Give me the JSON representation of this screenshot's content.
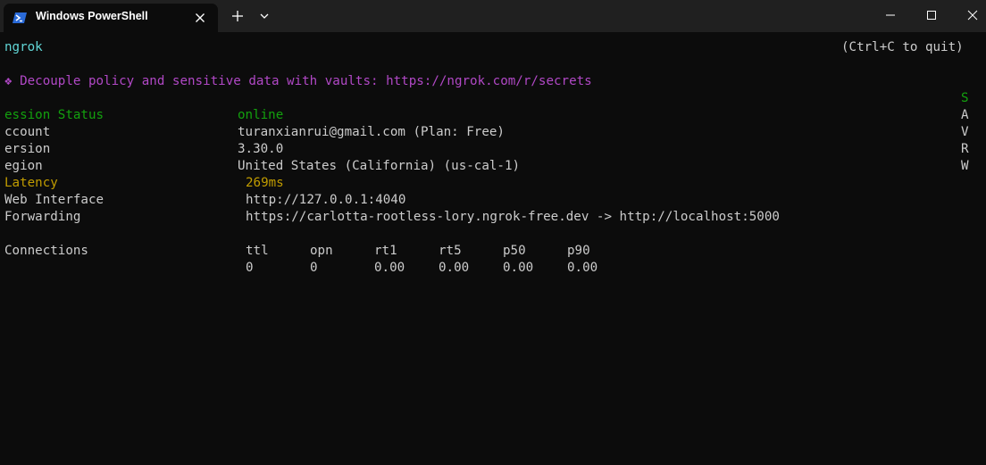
{
  "window": {
    "tab_title": "Windows PowerShell",
    "tab_icon": "powershell-icon",
    "close_tab_icon": "close-icon",
    "new_tab_icon": "plus-icon",
    "dropdown_icon": "chevron-down-icon",
    "minimize_icon": "minimize-icon",
    "maximize_icon": "maximize-icon",
    "close_icon": "close-icon"
  },
  "terminal": {
    "app_name": "ngrok",
    "quit_hint": "(Ctrl+C to quit)",
    "notice": "❖ Decouple policy and sensitive data with vaults: https://ngrok.com/r/secrets",
    "right_column": [
      "S",
      "A",
      "V",
      "R",
      "W"
    ],
    "status_rows": [
      {
        "label": "ession Status",
        "value": "online"
      },
      {
        "label": "ccount",
        "value": "turanxianrui@gmail.com (Plan: Free)"
      },
      {
        "label": "ersion",
        "value": "3.30.0"
      },
      {
        "label": "egion",
        "value": "United States (California) (us-cal-1)"
      },
      {
        "label": "Latency",
        "value": "269ms"
      },
      {
        "label": "Web Interface",
        "value": "http://127.0.0.1:4040"
      },
      {
        "label": "Forwarding",
        "value": "https://carlotta-rootless-lory.ngrok-free.dev -> http://localhost:5000"
      }
    ],
    "connections": {
      "label": "Connections",
      "headers": [
        "ttl",
        "opn",
        "rt1",
        "rt5",
        "p50",
        "p90"
      ],
      "values": [
        "0",
        "0",
        "0.00",
        "0.00",
        "0.00",
        "0.00"
      ]
    },
    "colors": {
      "background": "#0c0c0c",
      "text": "#cccccc",
      "cyan": "#61d6d6",
      "magenta": "#b148c6",
      "green": "#13a10e",
      "yellow": "#c19c00"
    }
  }
}
